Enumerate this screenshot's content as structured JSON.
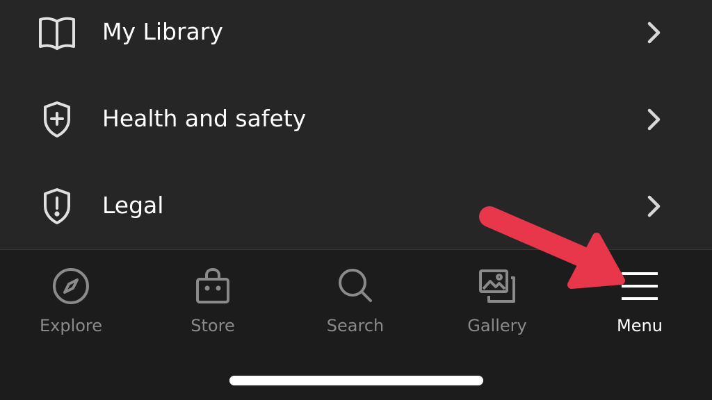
{
  "menu": {
    "items": [
      {
        "label": "My Library",
        "icon": "book-icon"
      },
      {
        "label": "Health and safety",
        "icon": "shield-plus-icon"
      },
      {
        "label": "Legal",
        "icon": "shield-exclamation-icon"
      }
    ]
  },
  "tab_bar": {
    "tabs": [
      {
        "label": "Explore",
        "icon": "compass-icon"
      },
      {
        "label": "Store",
        "icon": "shopping-bag-icon"
      },
      {
        "label": "Search",
        "icon": "search-icon"
      },
      {
        "label": "Gallery",
        "icon": "gallery-icon"
      },
      {
        "label": "Menu",
        "icon": "hamburger-icon",
        "active": true
      }
    ]
  },
  "colors": {
    "list_background": "#262626",
    "tab_bar_background": "#1c1c1c",
    "inactive_tab": "#8a8a8a",
    "active_tab": "#ffffff",
    "annotation_arrow": "#e8364a"
  }
}
